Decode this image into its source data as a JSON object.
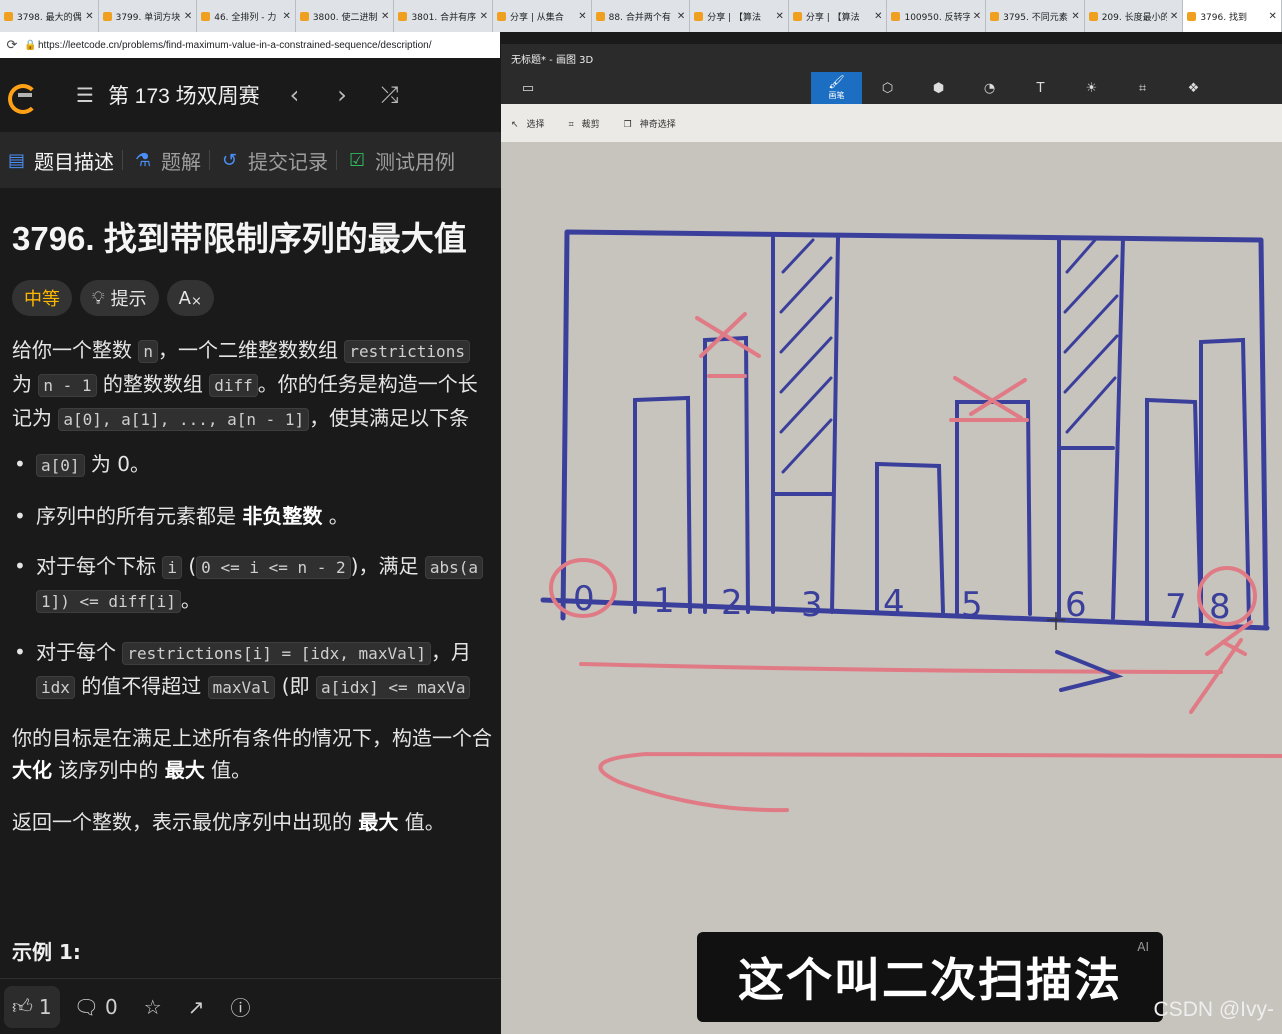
{
  "browser": {
    "tabs": [
      {
        "label": "3798. 最大的偶"
      },
      {
        "label": "3799. 单词方块"
      },
      {
        "label": "46. 全排列 - 力"
      },
      {
        "label": "3800. 使二进制"
      },
      {
        "label": "3801. 合并有序"
      },
      {
        "label": "分享 | 从集合"
      },
      {
        "label": "88. 合并两个有"
      },
      {
        "label": "分享 | 【算法"
      },
      {
        "label": "分享 | 【算法"
      },
      {
        "label": "100950. 反转字"
      },
      {
        "label": "3795. 不同元素"
      },
      {
        "label": "209. 长度最小的"
      },
      {
        "label": "3796. 找到"
      }
    ],
    "url": "https://leetcode.cn/problems/find-maximum-value-in-a-constrained-sequence/description/"
  },
  "leetcode": {
    "contest_title": "第 173 场双周赛",
    "tabs": [
      {
        "label": "题目描述",
        "icon": "description-icon"
      },
      {
        "label": "题解",
        "icon": "flask-icon"
      },
      {
        "label": "提交记录",
        "icon": "history-icon"
      },
      {
        "label": "测试用例",
        "icon": "checkbox-icon"
      }
    ],
    "problem_title": "3796. 找到带限制序列的最大值",
    "difficulty": "中等",
    "hint_label": "提示",
    "font_label": "A",
    "desc": {
      "p1a": "给你一个整数 ",
      "p1_n": "n",
      "p1b": "，一个二维整数数组 ",
      "p1_restrictions": "restrictions",
      "p2a": "为 ",
      "p2_n1": "n - 1",
      "p2b": " 的整数数组 ",
      "p2_diff": "diff",
      "p2c": "。你的任务是构造一个长",
      "p3a": "记为 ",
      "p3_seq": "a[0], a[1], ..., a[n - 1]",
      "p3b": "，使其满足以下条"
    },
    "bullets": {
      "b1_code": "a[0]",
      "b1_text": " 为 0。",
      "b2_a": "序列中的所有元素都是 ",
      "b2_b": "非负整数",
      "b2_c": " 。",
      "b3_a": "对于每个下标 ",
      "b3_i": "i",
      "b3_b": " (",
      "b3_range": "0 <= i <= n - 2",
      "b3_c": ")，满足 ",
      "b3_abs": "abs(a",
      "b3_cont": "1]) <= diff[i]",
      "b3_end": "。",
      "b4_a": "对于每个 ",
      "b4_code": "restrictions[i] = [idx, maxVal]",
      "b4_b": "，月",
      "b4_idx": "idx",
      "b4_c": " 的值不得超过 ",
      "b4_maxval": "maxVal",
      "b4_d": " (即 ",
      "b4_aidx": "a[idx] <= maxVa"
    },
    "goal": {
      "l1": "你的目标是在满足上述所有条件的情况下，构造一个合",
      "l2a": "大化",
      "l2b": " 该序列中的 ",
      "l2c": "最大",
      "l2d": " 值。"
    },
    "ret": {
      "a": "返回一个整数，表示最优序列中出现的 ",
      "b": "最大",
      "c": " 值。"
    },
    "example_label": "示例 1:",
    "footer": {
      "likes": "1",
      "comments": "0"
    }
  },
  "paint": {
    "title": "无标题* - 画图 3D",
    "tools": [
      {
        "name": "brush-tool",
        "label": "画笔"
      },
      {
        "name": "2d-shapes-tool",
        "label": ""
      },
      {
        "name": "3d-shapes-tool",
        "label": ""
      },
      {
        "name": "stickers-tool",
        "label": ""
      },
      {
        "name": "text-tool",
        "label": "T"
      },
      {
        "name": "effects-tool",
        "label": ""
      },
      {
        "name": "canvas-tool",
        "label": ""
      },
      {
        "name": "3d-library-tool",
        "label": ""
      }
    ],
    "subtools": {
      "select": "选择",
      "crop": "裁剪",
      "magic_select": "神奇选择"
    },
    "digits": [
      "0",
      "1",
      "2",
      "3",
      "4",
      "5",
      "6",
      "7",
      "8"
    ]
  },
  "subtitle": "这个叫二次扫描法",
  "subtitle_badge": "AI",
  "watermark": "CSDN @Ivy-"
}
